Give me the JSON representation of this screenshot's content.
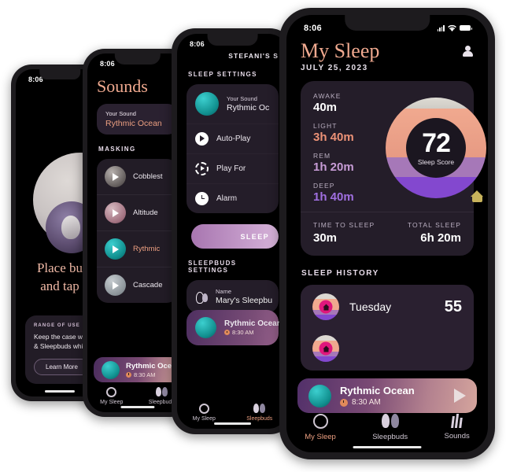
{
  "status_bar": {
    "time": "8:06",
    "icons": [
      "signal-bars-icon",
      "wifi-icon",
      "battery-icon"
    ]
  },
  "colors": {
    "accent_serif": "#f0a98f",
    "awake": "#dedbd4",
    "light": "#f0a98f",
    "rem": "#a678b8",
    "deep": "#8348cf",
    "card_bg": "#241d29",
    "screen_bg": "#000000"
  },
  "tab_bar": {
    "tabs": [
      {
        "label": "My Sleep",
        "icon": "ring-icon",
        "active": true
      },
      {
        "label": "Sleepbuds",
        "icon": "earbuds-icon",
        "active": false
      },
      {
        "label": "Sounds",
        "icon": "sound-bars-icon",
        "active": false
      }
    ]
  },
  "now_playing": {
    "title": "Rythmic Ocean",
    "time": "8:30 AM",
    "play_icon": "play-triangle-icon",
    "clock_icon": "clock-icon"
  },
  "phone1_setup": {
    "headline_line1": "Place bu",
    "headline_line2": "and tap",
    "card": {
      "kicker": "RANGE OF USE",
      "body_line1": "Keep the case with",
      "body_line2": "& Sleepbuds while",
      "button": "Learn More"
    }
  },
  "phone2_sounds": {
    "title": "Sounds",
    "your_sound": {
      "label": "Your Sound",
      "value": "Rythmic Ocean"
    },
    "section": "MASKING",
    "tracks": [
      {
        "name": "Cobblest",
        "thumb": "cobblestone-thumb",
        "selected": false
      },
      {
        "name": "Altitude",
        "thumb": "altitude-thumb",
        "selected": false
      },
      {
        "name": "Rythmic",
        "thumb": "rythmic-ocean-thumb",
        "selected": true
      },
      {
        "name": "Cascade",
        "thumb": "cascade-thumb",
        "selected": false
      }
    ]
  },
  "phone3_settings": {
    "header": "STEFANI'S S",
    "section_sleep": "SLEEP SETTINGS",
    "your_sound": {
      "label": "Your Sound",
      "value": "Rythmic Oc"
    },
    "rows": [
      {
        "label": "Auto-Play",
        "icon": "play-circle-icon"
      },
      {
        "label": "Play For",
        "icon": "timer-icon"
      },
      {
        "label": "Alarm",
        "icon": "clock-icon"
      }
    ],
    "big_button": "SLEEP",
    "section_buds": "SLEEPBUDS SETTINGS",
    "name_row": {
      "label": "Name",
      "value": "Mary's Sleepbu",
      "icon": "earbuds-icon"
    },
    "now_playing": {
      "title": "Rythmic Ocean",
      "time": "8:30 AM"
    }
  },
  "phone4_mysleep": {
    "title": "My Sleep",
    "date": "JULY 25, 2023",
    "avatar_icon": "avatar-icon",
    "stats": [
      {
        "label": "AWAKE",
        "value": "40m"
      },
      {
        "label": "LIGHT",
        "value": "3h 40m"
      },
      {
        "label": "REM",
        "value": "1h 20m"
      },
      {
        "label": "DEEP",
        "value": "1h 40m"
      }
    ],
    "score": {
      "value": "72",
      "label": "Sleep Score"
    },
    "home_icon": "home-icon",
    "summary": [
      {
        "label": "TIME TO SLEEP",
        "value": "30m"
      },
      {
        "label": "TOTAL SLEEP",
        "value": "6h 20m"
      }
    ],
    "history_section": "SLEEP HISTORY",
    "history": [
      {
        "day": "Tuesday",
        "score": "55",
        "icon": "mini-donut-icon"
      }
    ]
  },
  "chart_data": {
    "type": "pie",
    "title": "Sleep Score",
    "center_value": 72,
    "categories": [
      "Awake",
      "Light",
      "REM",
      "Deep"
    ],
    "values": [
      40,
      220,
      80,
      100
    ],
    "value_labels": [
      "40m",
      "3h 40m",
      "1h 20m",
      "1h 40m"
    ],
    "colors": [
      "#dedbd4",
      "#f0a98f",
      "#a678b8",
      "#8348cf"
    ],
    "legend": "left",
    "total_sleep": "6h 20m",
    "time_to_sleep": "30m"
  }
}
